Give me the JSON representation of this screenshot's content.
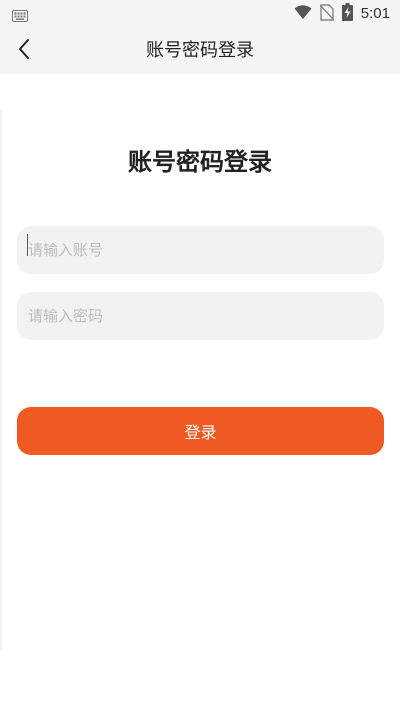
{
  "status_bar": {
    "time": "5:01",
    "icons": [
      "keyboard-icon",
      "wifi-icon",
      "no-sim-icon",
      "battery-charging-icon"
    ]
  },
  "app_bar": {
    "title": "账号密码登录",
    "back_icon": "chevron-left-icon"
  },
  "login_form": {
    "heading": "账号密码登录",
    "account_placeholder": "请输入账号",
    "password_placeholder": "请输入密码",
    "submit_label": "登录"
  },
  "colors": {
    "accent": "#f05a22",
    "field_background": "#f2f2f2",
    "bar_background": "#f5f5f5"
  }
}
